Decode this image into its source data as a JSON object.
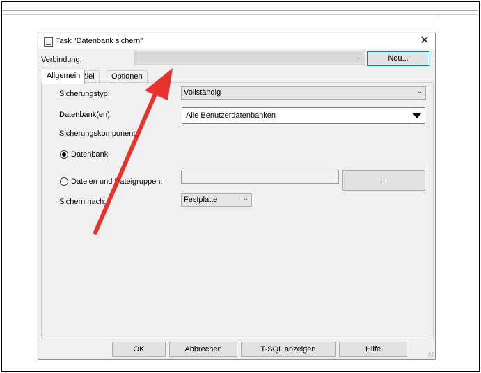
{
  "dialog": {
    "title": "Task \"Datenbank sichern\"",
    "close_glyph": "✕"
  },
  "connection": {
    "label": "Verbindung:",
    "value": "",
    "new_button": "Neu..."
  },
  "tabs": [
    {
      "label": "Allgemein",
      "active": true
    },
    {
      "label": "Ziel",
      "active": false
    },
    {
      "label": "Optionen",
      "active": false
    }
  ],
  "general": {
    "backup_type_label": "Sicherungstyp:",
    "backup_type_value": "Vollständig",
    "databases_label": "Datenbank(en):",
    "databases_value": "Alle Benutzerdatenbanken",
    "component_label": "Sicherungskomponente",
    "radio_database_label": "Datenbank",
    "radio_files_label": "Dateien und Dateigruppen:",
    "files_button": "...",
    "backup_to_label": "Sichern nach:",
    "backup_to_value": "Festplatte"
  },
  "buttons": {
    "ok": "OK",
    "cancel": "Abbrechen",
    "tsql": "T-SQL anzeigen",
    "help": "Hilfe"
  },
  "colors": {
    "annotation_arrow": "#e8322c",
    "focus_border": "#0078d7"
  },
  "icons": {
    "title": "task-icon",
    "close": "close-icon",
    "dropdown": "chevron-down-icon"
  }
}
